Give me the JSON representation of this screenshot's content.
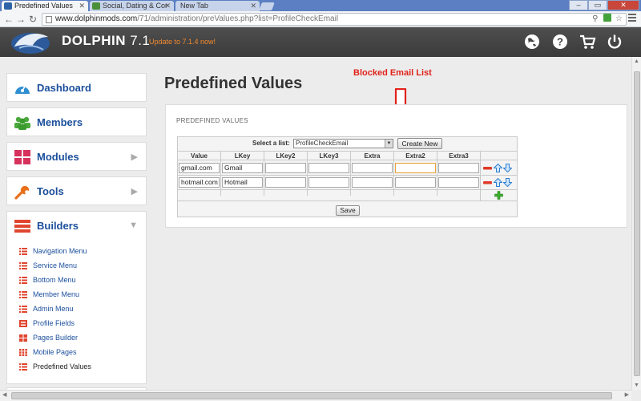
{
  "browser": {
    "tabs": [
      {
        "title": "Predefined Values",
        "active": true
      },
      {
        "title": "Social, Dating & Cor",
        "active": false
      },
      {
        "title": "New Tab",
        "active": false
      }
    ],
    "url_host": "www.dolphinmods.com",
    "url_path": "/71/administration/preValues.php?list=ProfileCheckEmail"
  },
  "header": {
    "brand": "DOLPHIN",
    "version": "7.1",
    "update_link": "Update to 7.1.4 now!",
    "icons": [
      "globe-icon",
      "help-icon",
      "cart-icon",
      "power-icon"
    ]
  },
  "sidebar": {
    "items": [
      {
        "label": "Dashboard",
        "icon": "dashboard-icon",
        "arrow": ""
      },
      {
        "label": "Members",
        "icon": "members-icon",
        "arrow": ""
      },
      {
        "label": "Modules",
        "icon": "modules-icon",
        "arrow": "▶"
      },
      {
        "label": "Tools",
        "icon": "wrench-icon",
        "arrow": "▶"
      },
      {
        "label": "Builders",
        "icon": "list-icon",
        "arrow": "▼"
      }
    ],
    "builders_submenu": [
      {
        "label": "Navigation Menu",
        "icon": "list-icon"
      },
      {
        "label": "Service Menu",
        "icon": "list-icon"
      },
      {
        "label": "Bottom Menu",
        "icon": "list-icon"
      },
      {
        "label": "Member Menu",
        "icon": "list-icon"
      },
      {
        "label": "Admin Menu",
        "icon": "list-icon"
      },
      {
        "label": "Profile Fields",
        "icon": "fields-icon"
      },
      {
        "label": "Pages Builder",
        "icon": "pages-icon"
      },
      {
        "label": "Mobile Pages",
        "icon": "mobile-grid-icon"
      },
      {
        "label": "Predefined Values",
        "icon": "list-icon",
        "current": true
      }
    ]
  },
  "main": {
    "page_title": "Predefined Values",
    "annotation": "Blocked Email List",
    "panel_caption": "PREDEFINED VALUES",
    "select_label": "Select a list:",
    "select_value": "ProfileCheckEmail",
    "create_button": "Create New",
    "columns": [
      "Value",
      "LKey",
      "LKey2",
      "LKey3",
      "Extra",
      "Extra2",
      "Extra3"
    ],
    "rows": [
      [
        "gmail.com",
        "Gmail",
        "",
        "",
        "",
        "",
        ""
      ],
      [
        "hotmail.com",
        "Hotmail",
        "",
        "",
        "",
        "",
        ""
      ]
    ],
    "save_button": "Save"
  },
  "colors": {
    "accent_blue": "#1c4f9c",
    "annotation_red": "#e0231b",
    "update_orange": "#f28a2e",
    "header_bg": "#444444"
  }
}
